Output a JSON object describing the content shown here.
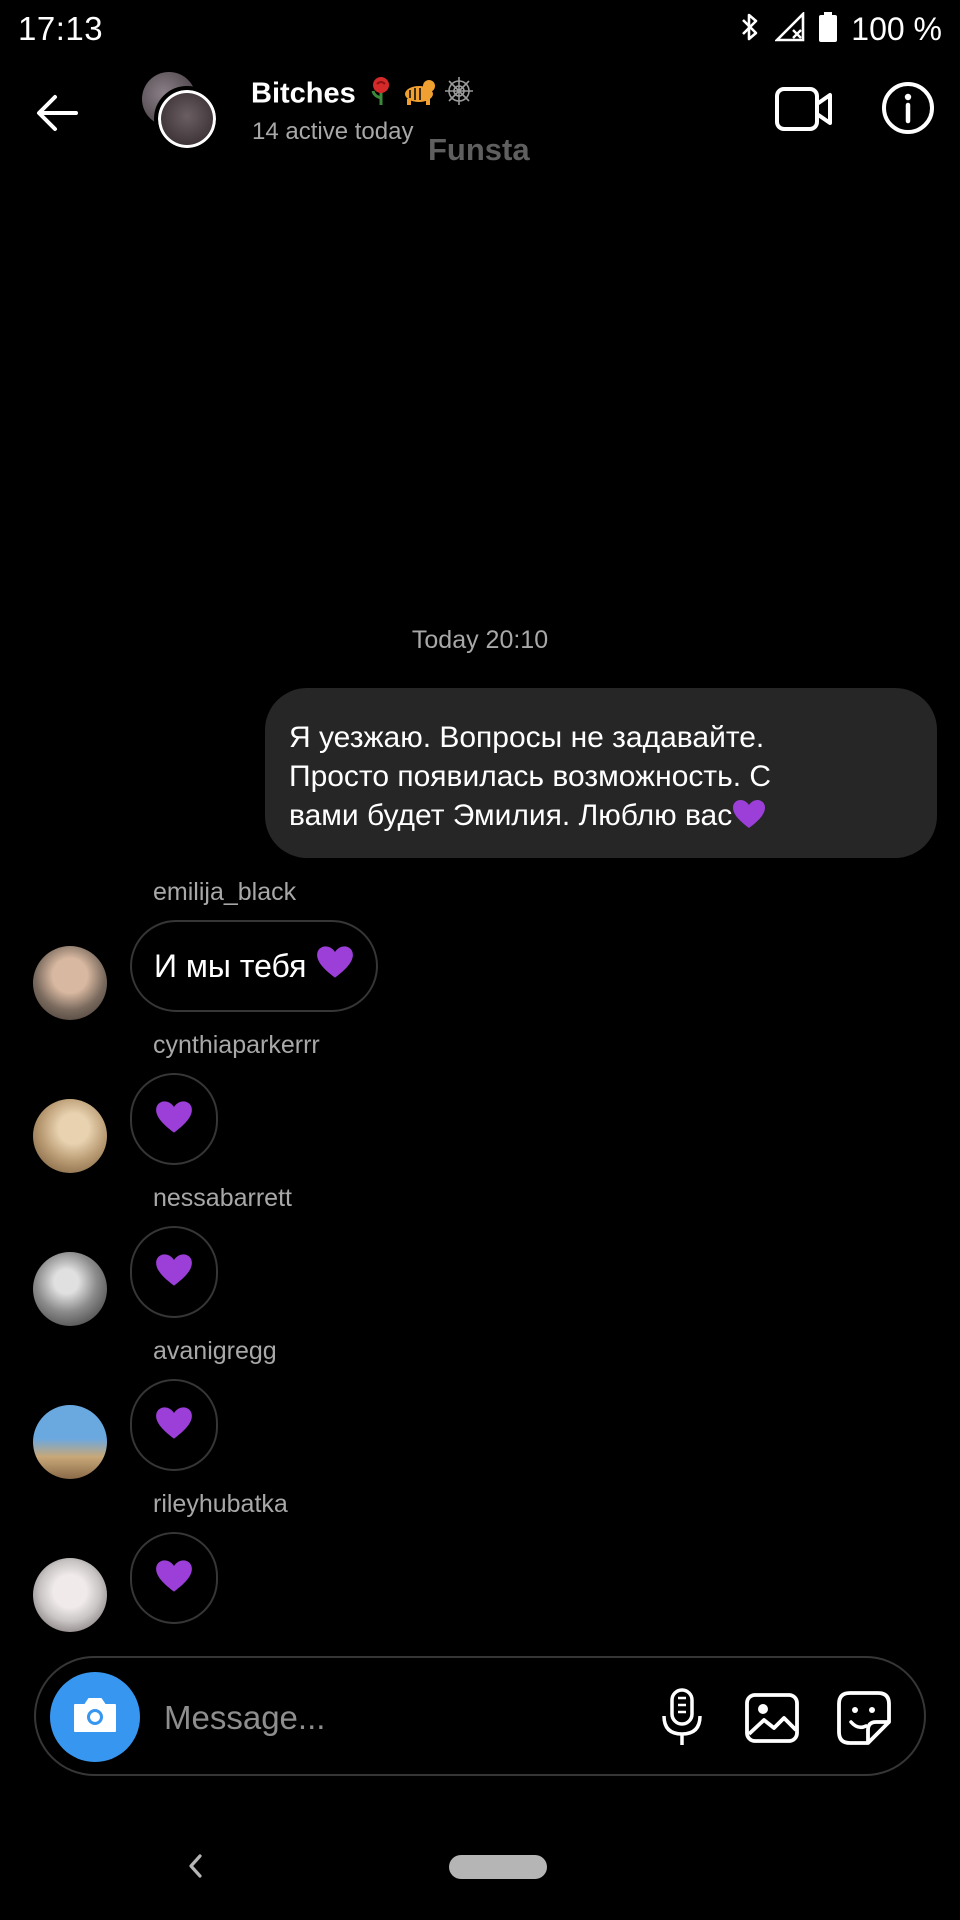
{
  "status_bar": {
    "time": "17:13",
    "battery": "100 %",
    "icons": [
      "bluetooth-icon",
      "signal-icon",
      "battery-icon"
    ]
  },
  "header": {
    "title": "Bitches",
    "title_emojis": [
      "rose",
      "tiger",
      "spider-web"
    ],
    "subtitle": "14 active today",
    "overlay_label": "Funsta",
    "icons": [
      "back-arrow-icon",
      "video-call-icon",
      "info-icon"
    ]
  },
  "conversation": {
    "timestamp": "Today 20:10",
    "outgoing_message": {
      "lines": [
        "Я уезжаю. Вопросы не задавайте.",
        "Просто появилась возможность. С",
        "вами будет Эмилия. Люблю вас"
      ],
      "trailing_emoji": "purple-heart"
    },
    "incoming": [
      {
        "sender": "emilija_black",
        "text": "И мы тебя",
        "emoji": "purple-heart",
        "avatar_color": "#7a6a5e"
      },
      {
        "sender": "cynthiaparkerrr",
        "text": "",
        "emoji": "purple-heart",
        "avatar_color": "#b89a72"
      },
      {
        "sender": "nessabarrett",
        "text": "",
        "emoji": "purple-heart",
        "avatar_color": "#8c8c8c"
      },
      {
        "sender": "avanigregg",
        "text": "",
        "emoji": "purple-heart",
        "avatar_color": "#6a8ab0"
      },
      {
        "sender": "rileyhubatka",
        "text": "",
        "emoji": "purple-heart",
        "avatar_color": "#c8c4c4"
      }
    ]
  },
  "composer": {
    "placeholder": "Message...",
    "icons": [
      "camera-icon",
      "microphone-icon",
      "gallery-icon",
      "sticker-icon"
    ]
  },
  "colors": {
    "background": "#000000",
    "bubble_outgoing": "#262626",
    "bubble_border": "#363636",
    "accent_blue": "#3797f0",
    "heart_purple": "#9b3fd8",
    "secondary_text": "#a8a8a8"
  }
}
